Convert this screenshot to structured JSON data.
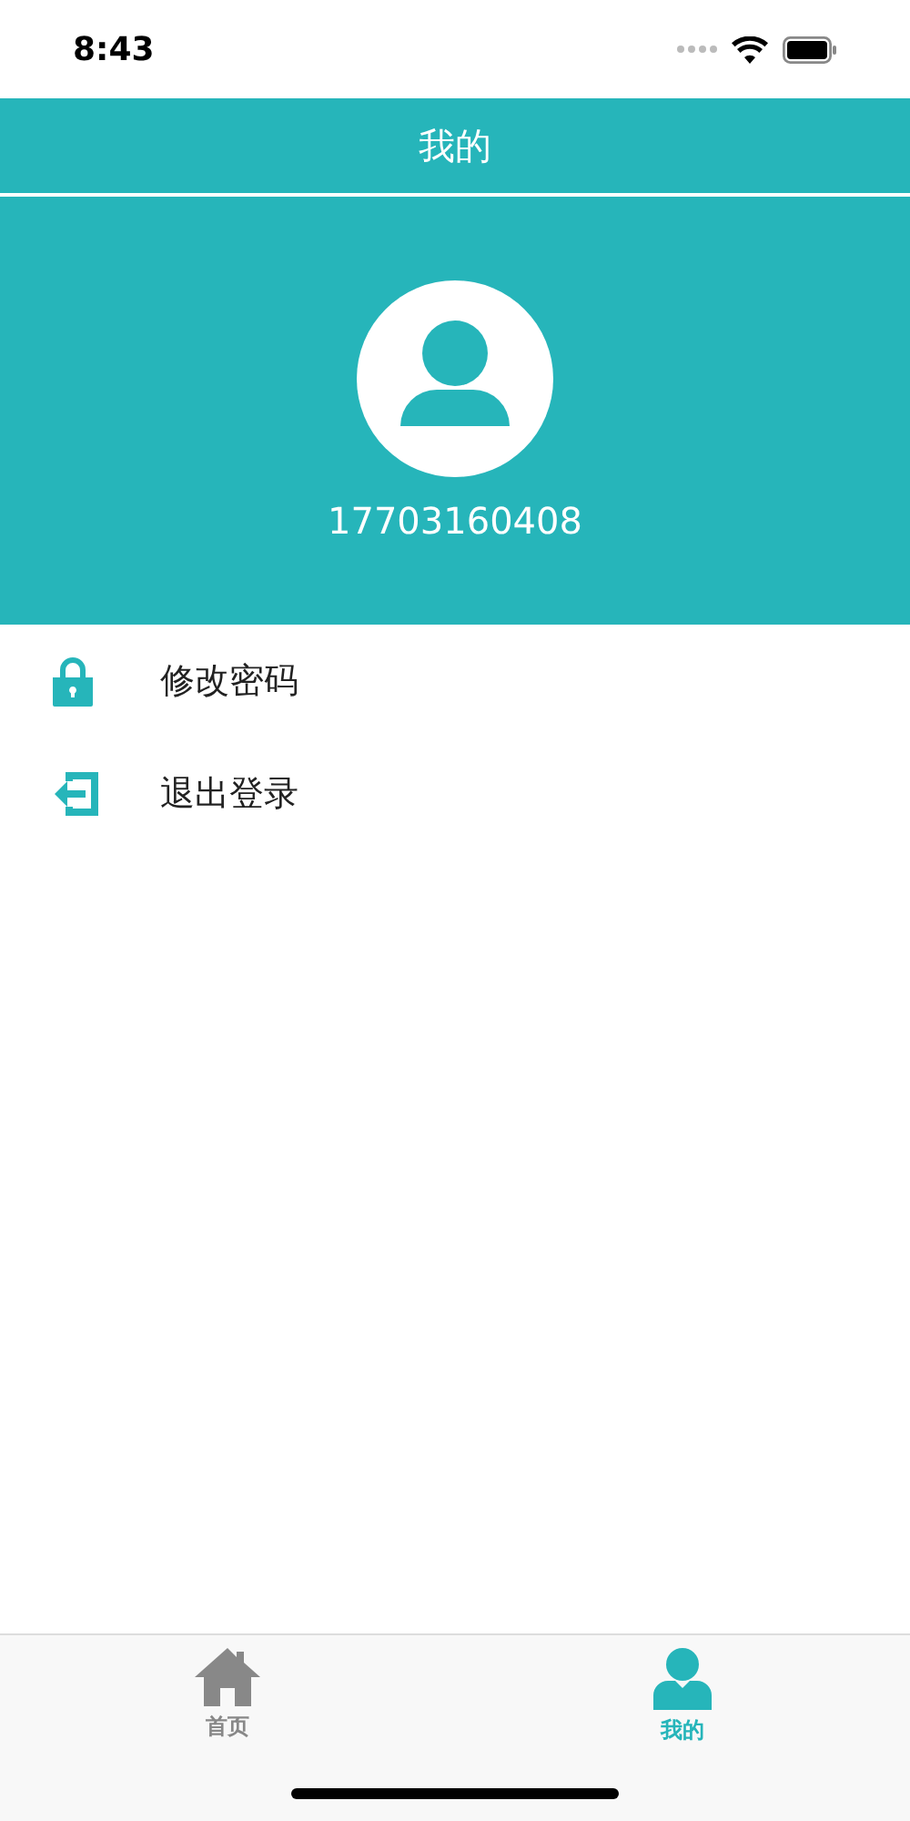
{
  "status_bar": {
    "time": "8:43"
  },
  "header": {
    "title": "我的"
  },
  "profile": {
    "phone": "17703160408"
  },
  "menu": [
    {
      "kind": "lock",
      "label": "修改密码"
    },
    {
      "kind": "exit",
      "label": "退出登录"
    }
  ],
  "tab_bar": [
    {
      "kind": "home",
      "label": "首页",
      "selected": false
    },
    {
      "kind": "person",
      "label": "我的",
      "selected": true
    }
  ]
}
